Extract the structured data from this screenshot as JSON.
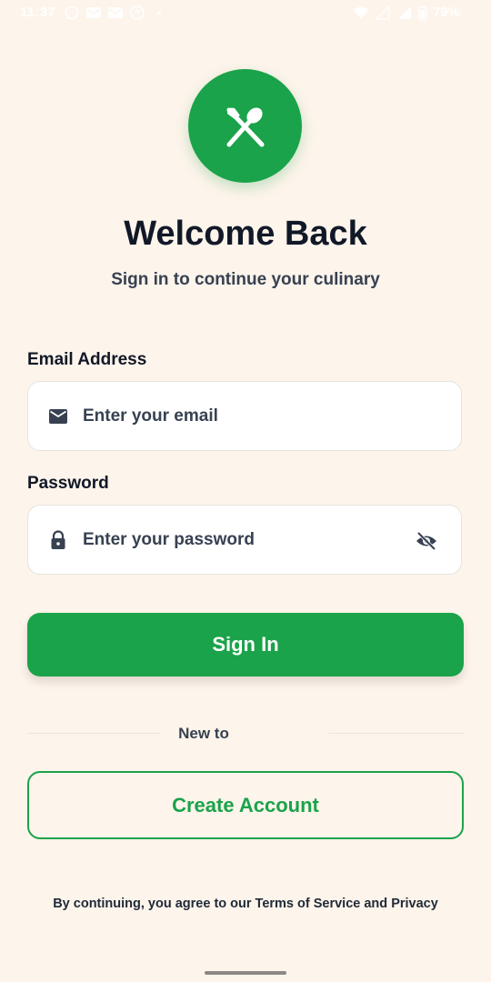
{
  "status_bar": {
    "time": "11:37",
    "battery_percent": "79%",
    "icons_left": [
      "whatsapp-icon",
      "mail-icon",
      "mail-icon",
      "messenger-icon",
      "dot-icon"
    ],
    "icons_right": [
      "wifi-icon",
      "signal-icon",
      "signal-icon",
      "battery-icon"
    ]
  },
  "logo": {
    "icon": "fork-spoon-icon",
    "color": "#1aa34a"
  },
  "header": {
    "title": "Welcome Back",
    "subtitle": "Sign in to continue your culinary"
  },
  "form": {
    "email": {
      "label": "Email Address",
      "placeholder": "Enter your email",
      "value": "",
      "icon": "mail-icon"
    },
    "password": {
      "label": "Password",
      "placeholder": "Enter your password",
      "value": "",
      "icon": "lock-icon",
      "toggle_icon": "eye-off-icon"
    },
    "sign_in_label": "Sign In"
  },
  "divider": {
    "text": "New to"
  },
  "create_account_label": "Create Account",
  "footer": {
    "prefix": "By continuing, you agree to our ",
    "terms": "Terms of Service",
    "and": " and ",
    "privacy": "Privacy"
  },
  "colors": {
    "background": "#fdf4eb",
    "primary": "#1aa34a",
    "text_dark": "#111827"
  }
}
